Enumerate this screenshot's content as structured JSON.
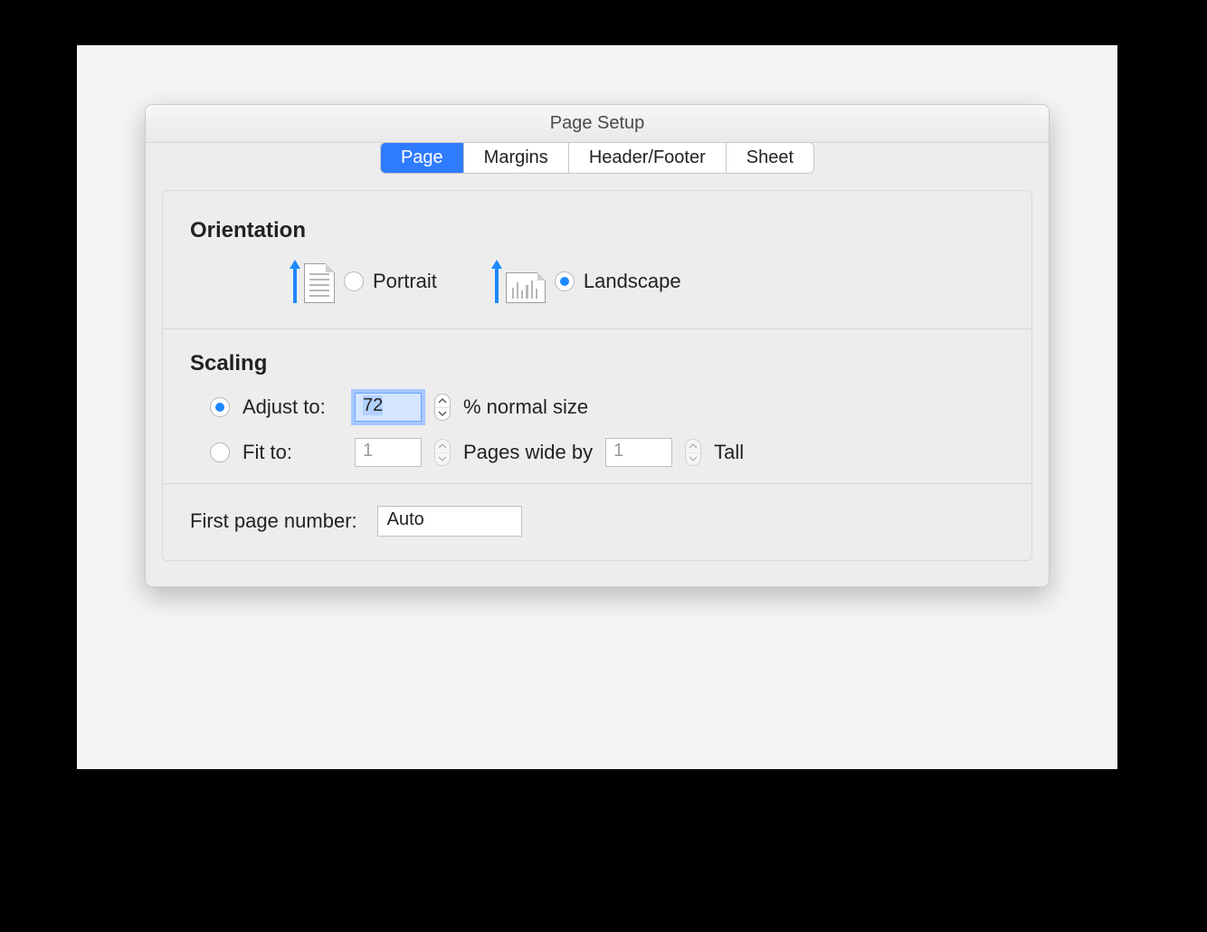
{
  "window": {
    "title": "Page Setup"
  },
  "tabs": {
    "page": "Page",
    "margins": "Margins",
    "header_footer": "Header/Footer",
    "sheet": "Sheet",
    "active": "page"
  },
  "orientation": {
    "heading": "Orientation",
    "portrait_label": "Portrait",
    "landscape_label": "Landscape",
    "selected": "landscape"
  },
  "scaling": {
    "heading": "Scaling",
    "adjust_label": "Adjust to:",
    "adjust_value": "72",
    "adjust_suffix": "% normal size",
    "fit_label": "Fit to:",
    "fit_wide_value": "1",
    "fit_mid_label": "Pages wide by",
    "fit_tall_value": "1",
    "fit_tall_label": "Tall",
    "selected": "adjust"
  },
  "first_page": {
    "label": "First page number:",
    "value": "Auto"
  }
}
